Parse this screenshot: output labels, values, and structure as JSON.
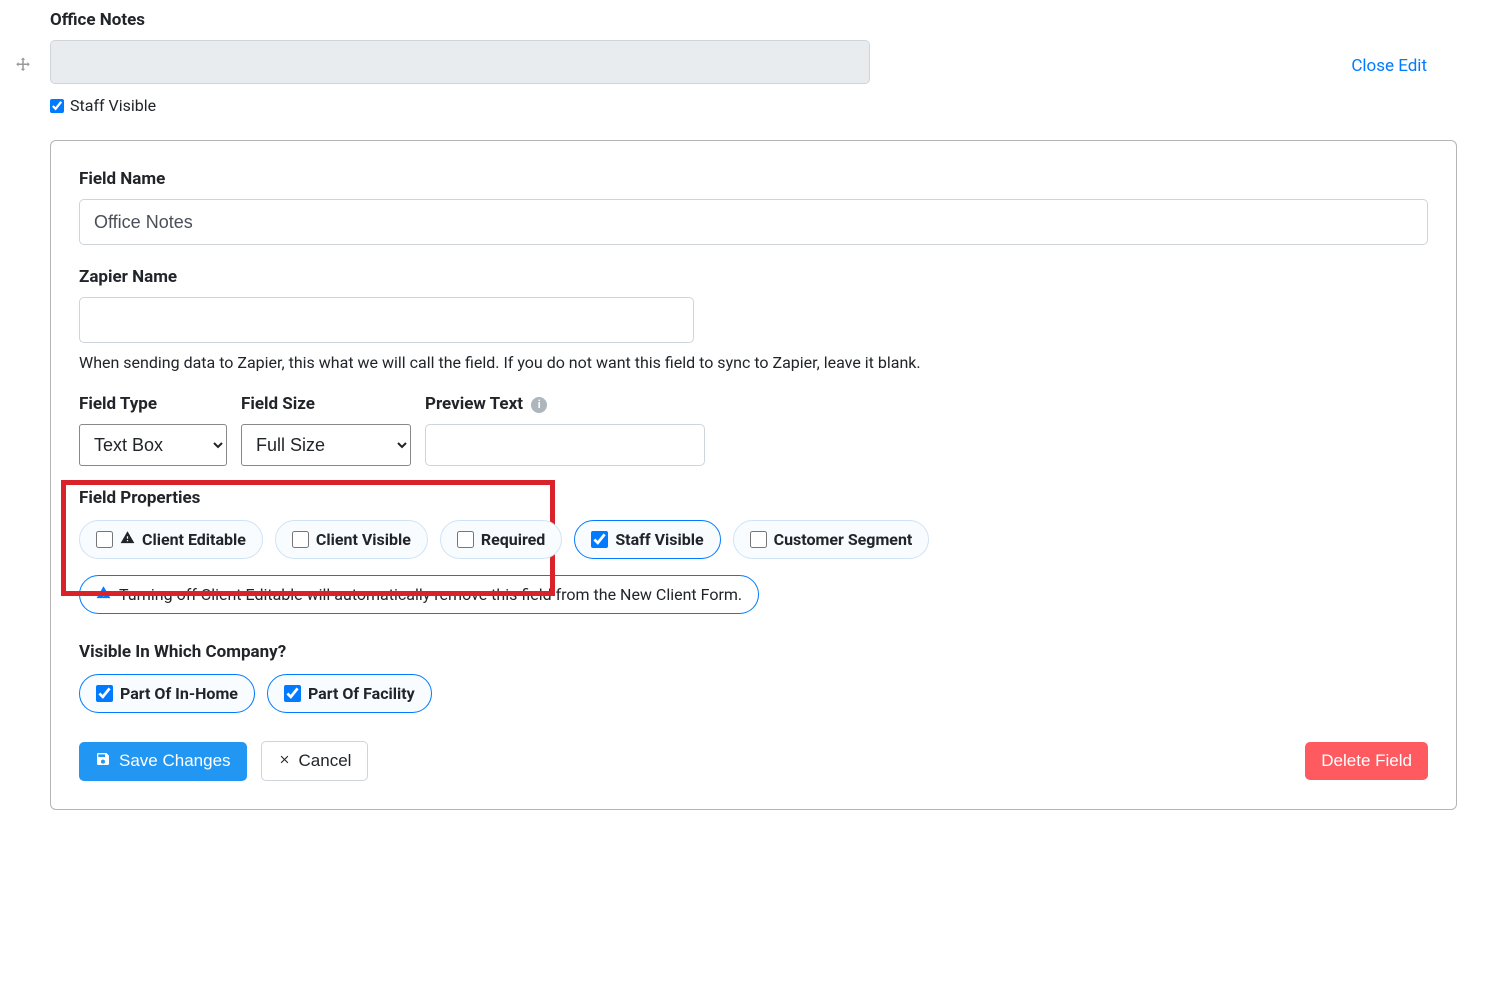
{
  "top": {
    "label": "Office Notes",
    "staff_visible_label": "Staff Visible",
    "staff_visible_checked": true,
    "close_edit": "Close Edit"
  },
  "form": {
    "field_name_label": "Field Name",
    "field_name_value": "Office Notes",
    "zapier_name_label": "Zapier Name",
    "zapier_name_value": "",
    "zapier_help": "When sending data to Zapier, this what we will call the field. If you do not want this field to sync to Zapier, leave it blank.",
    "field_type_label": "Field Type",
    "field_type_value": "Text Box",
    "field_size_label": "Field Size",
    "field_size_value": "Full Size",
    "preview_text_label": "Preview Text",
    "preview_text_value": ""
  },
  "properties": {
    "section_label": "Field Properties",
    "client_editable": "Client Editable",
    "client_visible": "Client Visible",
    "required": "Required",
    "staff_visible": "Staff Visible",
    "customer_segment": "Customer Segment",
    "warning": "Turning off Client Editable will automatically remove this field from the New Client Form."
  },
  "company": {
    "section_label": "Visible In Which Company?",
    "in_home": "Part Of In-Home",
    "facility": "Part Of Facility"
  },
  "buttons": {
    "save": "Save Changes",
    "cancel": "Cancel",
    "delete": "Delete Field"
  }
}
